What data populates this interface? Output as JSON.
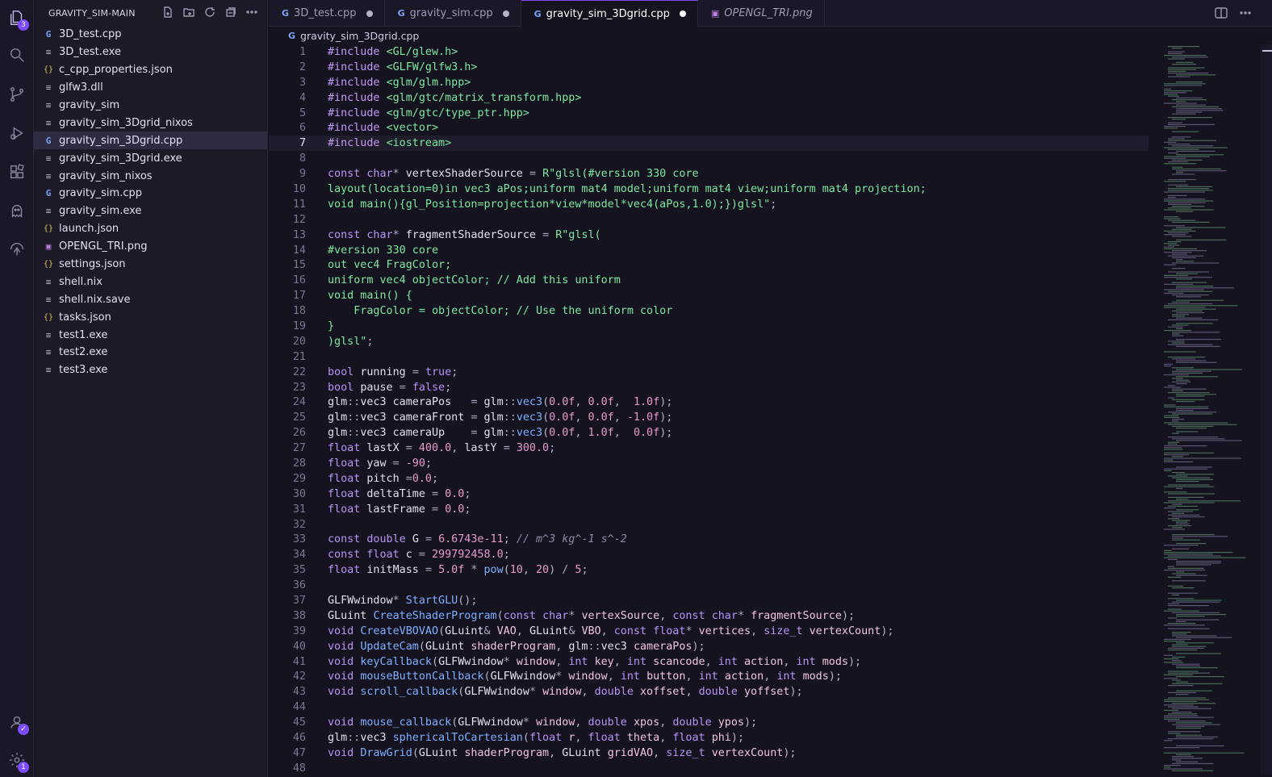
{
  "activity_bar": {
    "explorer_badge": "3",
    "settings_badge": "1"
  },
  "sidebar": {
    "title": "GRAVITY_SIM-MAIN",
    "files": [
      {
        "name": "3D_test.cpp",
        "icon": "cpp"
      },
      {
        "name": "3D_test.exe",
        "icon": "txt"
      },
      {
        "name": "c_cpp_properties.json",
        "icon": "json"
      },
      {
        "name": "glfw3.dll",
        "icon": "txt"
      },
      {
        "name": "gravity_sim",
        "icon": "txt"
      },
      {
        "name": "gravity_sim_3Dgrid_nixos",
        "icon": "txt"
      },
      {
        "name": "gravity_sim_3Dgrid.cpp",
        "icon": "cpp",
        "selected": true
      },
      {
        "name": "gravity_sim_3Dgrid.exe",
        "icon": "txt"
      },
      {
        "name": "gravity_sim_nixos",
        "icon": "txt"
      },
      {
        "name": "gravity_sim.cpp",
        "icon": "cpp"
      },
      {
        "name": "gravity_sim.exe",
        "icon": "txt"
      },
      {
        "name": "launch.json",
        "icon": "json"
      },
      {
        "name": "OPENGL_TRI.png",
        "icon": "png"
      },
      {
        "name": "settings.json",
        "icon": "json"
      },
      {
        "name": "shell.nix",
        "icon": "txt"
      },
      {
        "name": "shell.nix.save",
        "icon": "txt"
      },
      {
        "name": "tasks.json",
        "icon": "json"
      },
      {
        "name": "test1.exe",
        "icon": "txt"
      },
      {
        "name": "test2.exe",
        "icon": "txt"
      },
      {
        "name": "test3.exe",
        "icon": "txt"
      }
    ]
  },
  "tabs": [
    {
      "label": "3D_test.cpp",
      "icon": "cpp",
      "modified": true,
      "active": false
    },
    {
      "label": "gravity_sim.cpp",
      "icon": "cpp",
      "modified": true,
      "active": false
    },
    {
      "label": "gravity_sim_3Dgrid.cpp",
      "icon": "cpp",
      "modified": true,
      "active": true
    },
    {
      "label": "OPENGL_TRI.png",
      "icon": "png",
      "modified": false,
      "active": false,
      "italic": true
    }
  ],
  "breadcrumb": "gravity_sim_3Dgrid.cpp",
  "current_line": 7,
  "code_lines": [
    [
      [
        "pp",
        "#include "
      ],
      [
        "s",
        "<GL/glew.h>"
      ]
    ],
    [
      [
        "pp",
        "#include "
      ],
      [
        "s",
        "<GLFW/glfw3.h>"
      ]
    ],
    [
      [
        "pp",
        "#include "
      ],
      [
        "s",
        "<glm/glm.hpp>"
      ]
    ],
    [
      [
        "pp",
        "#include "
      ],
      [
        "s",
        "<glm/gtc/matrix_transform.hpp>"
      ]
    ],
    [
      [
        "pp",
        "#include "
      ],
      [
        "s",
        "<glm/gtc/type_ptr.hpp>"
      ]
    ],
    [
      [
        "pp",
        "#include "
      ],
      [
        "s",
        "<vector>"
      ]
    ],
    [
      [
        "pp",
        "#include "
      ],
      [
        "s",
        "<iostream>"
      ]
    ],
    [],
    [
      [
        "k",
        "const "
      ],
      [
        "t",
        "char"
      ],
      [
        "op",
        "* "
      ],
      [
        "v",
        "vertexShaderSource "
      ],
      [
        "op",
        "= "
      ],
      [
        "s",
        "R\"glsl(#version 330 core"
      ]
    ],
    [
      [
        "s",
        "layout(location=0)in vec3 aPos;uniform mat4 model;uniform mat4 view;uniform mat4 projection;"
      ]
    ],
    [
      [
        "s",
        "void main(){gl_Position=projection*view*model*vec4(aPos,1.0);})glsl\""
      ],
      [
        "p",
        ";"
      ]
    ],
    [],
    [
      [
        "k",
        "const "
      ],
      [
        "t",
        "char"
      ],
      [
        "op",
        "* "
      ],
      [
        "v",
        "fragmentShaderSource "
      ],
      [
        "op",
        "= "
      ],
      [
        "s",
        "R\"glsl("
      ]
    ],
    [
      [
        "s",
        "#version 330 core"
      ]
    ],
    [
      [
        "s",
        "out vec4 FragColor;"
      ]
    ],
    [
      [
        "s",
        "uniform vec4 objectColor; // Add this uniform"
      ]
    ],
    [
      [
        "s",
        "void main() {"
      ]
    ],
    [
      [
        "s",
        "    FragColor = objectColor; // Use the uniform color"
      ]
    ],
    [
      [
        "s",
        "}"
      ]
    ],
    [
      [
        "s",
        ")glsl\""
      ],
      [
        "p",
        ";"
      ]
    ],
    [],
    [
      [
        "t",
        "bool "
      ],
      [
        "v",
        "running "
      ],
      [
        "op",
        "= "
      ],
      [
        "k",
        "true"
      ],
      [
        "p",
        ";"
      ]
    ],
    [
      [
        "t",
        "bool "
      ],
      [
        "v",
        "pause "
      ],
      [
        "op",
        "= "
      ],
      [
        "k",
        "false"
      ],
      [
        "p",
        ";"
      ]
    ],
    [
      [
        "v",
        "glm"
      ],
      [
        "op",
        "::"
      ],
      [
        "v",
        "vec3 cameraPos   "
      ],
      [
        "op",
        "= "
      ],
      [
        "v",
        "glm"
      ],
      [
        "op",
        "::"
      ],
      [
        "f",
        "vec3"
      ],
      [
        "p",
        "("
      ],
      [
        "n",
        "0.0f"
      ],
      [
        "p",
        ", "
      ],
      [
        "n",
        "0.0f"
      ],
      [
        "p",
        ",  "
      ],
      [
        "n",
        "1.0f"
      ],
      [
        "p",
        ");"
      ]
    ],
    [
      [
        "v",
        "glm"
      ],
      [
        "op",
        "::"
      ],
      [
        "v",
        "vec3 cameraFront "
      ],
      [
        "op",
        "= "
      ],
      [
        "v",
        "glm"
      ],
      [
        "op",
        "::"
      ],
      [
        "f",
        "vec3"
      ],
      [
        "p",
        "("
      ],
      [
        "n",
        "0.0f"
      ],
      [
        "p",
        ", "
      ],
      [
        "n",
        "0.0f"
      ],
      [
        "p",
        ", "
      ],
      [
        "n",
        "-1.0f"
      ],
      [
        "p",
        ");"
      ]
    ],
    [
      [
        "v",
        "glm"
      ],
      [
        "op",
        "::"
      ],
      [
        "v",
        "vec3 cameraUp    "
      ],
      [
        "op",
        "= "
      ],
      [
        "v",
        "glm"
      ],
      [
        "op",
        "::"
      ],
      [
        "f",
        "vec3"
      ],
      [
        "p",
        "("
      ],
      [
        "n",
        "0.0f"
      ],
      [
        "p",
        ", "
      ],
      [
        "n",
        "1.0f"
      ],
      [
        "p",
        ",  "
      ],
      [
        "n",
        "0.0f"
      ],
      [
        "p",
        ");"
      ]
    ],
    [
      [
        "t",
        "float "
      ],
      [
        "v",
        "lastX "
      ],
      [
        "op",
        "= "
      ],
      [
        "n",
        "400.0"
      ],
      [
        "p",
        ", "
      ],
      [
        "v",
        "lastY "
      ],
      [
        "op",
        "= "
      ],
      [
        "n",
        "300.0"
      ],
      [
        "p",
        ";"
      ]
    ],
    [
      [
        "t",
        "float "
      ],
      [
        "v",
        "yaw "
      ],
      [
        "op",
        "= "
      ],
      [
        "n",
        "-90"
      ],
      [
        "p",
        ";"
      ]
    ],
    [
      [
        "t",
        "float "
      ],
      [
        "v",
        "pitch "
      ],
      [
        "op",
        "="
      ],
      [
        "n",
        "0.0"
      ],
      [
        "p",
        ";"
      ]
    ],
    [
      [
        "t",
        "float "
      ],
      [
        "v",
        "deltaTime "
      ],
      [
        "op",
        "= "
      ],
      [
        "n",
        "0.0"
      ],
      [
        "p",
        ";"
      ]
    ],
    [
      [
        "t",
        "float "
      ],
      [
        "v",
        "lastFrame "
      ],
      [
        "op",
        "= "
      ],
      [
        "n",
        "0.0"
      ],
      [
        "p",
        ";"
      ]
    ],
    [],
    [
      [
        "k",
        "const "
      ],
      [
        "t",
        "double "
      ],
      [
        "v",
        "G "
      ],
      [
        "op",
        "= "
      ],
      [
        "n",
        "6.6743e-11"
      ],
      [
        "p",
        "; "
      ],
      [
        "c",
        "// m^3 kg^-1 s^-2"
      ]
    ],
    [
      [
        "k",
        "const "
      ],
      [
        "t",
        "float "
      ],
      [
        "v",
        "c "
      ],
      [
        "op",
        "= "
      ],
      [
        "n",
        "299792458.0"
      ],
      [
        "p",
        ";"
      ]
    ],
    [
      [
        "t",
        "float "
      ],
      [
        "v",
        "initMass "
      ],
      [
        "op",
        "= "
      ],
      [
        "n",
        "5.0f "
      ],
      [
        "op",
        "* "
      ],
      [
        "f",
        "pow"
      ],
      [
        "p",
        "("
      ],
      [
        "n",
        "10"
      ],
      [
        "p",
        ", "
      ],
      [
        "n",
        "20"
      ],
      [
        "p",
        ") "
      ],
      [
        "op",
        "/ "
      ],
      [
        "n",
        "5"
      ],
      [
        "p",
        ";"
      ]
    ],
    [],
    [
      [
        "v",
        "GLFWwindow"
      ],
      [
        "op",
        "* "
      ],
      [
        "f",
        "StartGLU"
      ],
      [
        "p",
        "();"
      ]
    ],
    [
      [
        "v",
        "GLuint "
      ],
      [
        "f",
        "CreateShaderProgram"
      ],
      [
        "p",
        "("
      ],
      [
        "k",
        "const "
      ],
      [
        "t",
        "char"
      ],
      [
        "op",
        "* "
      ],
      [
        "pm",
        "vertexSource"
      ],
      [
        "p",
        ", "
      ],
      [
        "k",
        "const "
      ],
      [
        "t",
        "char"
      ],
      [
        "op",
        "* "
      ],
      [
        "pm",
        "fragmentSource"
      ],
      [
        "p",
        ");"
      ]
    ],
    [
      [
        "t",
        "void "
      ],
      [
        "f",
        "CreateVBOVAO"
      ],
      [
        "p",
        "("
      ],
      [
        "v",
        "GLuint"
      ],
      [
        "op",
        "& "
      ],
      [
        "pm",
        "VAO"
      ],
      [
        "p",
        ", "
      ],
      [
        "v",
        "GLuint"
      ],
      [
        "op",
        "& "
      ],
      [
        "pm",
        "VBO"
      ],
      [
        "p",
        ", "
      ],
      [
        "k",
        "const "
      ],
      [
        "t",
        "float"
      ],
      [
        "op",
        "* "
      ],
      [
        "pm",
        "vertices"
      ],
      [
        "p",
        ", "
      ],
      [
        "t",
        "size_t "
      ],
      [
        "pm",
        "vertexCount"
      ],
      [
        "p",
        ");"
      ]
    ],
    [
      [
        "t",
        "void "
      ],
      [
        "f",
        "UpdateCam"
      ],
      [
        "p",
        "("
      ],
      [
        "v",
        "GLuint "
      ],
      [
        "pm",
        "shaderProgram"
      ],
      [
        "p",
        ", "
      ],
      [
        "v",
        "glm"
      ],
      [
        "op",
        "::"
      ],
      [
        "v",
        "vec3 "
      ],
      [
        "pm",
        "cameraPos"
      ],
      [
        "p",
        ");"
      ]
    ],
    [
      [
        "t",
        "void "
      ],
      [
        "f",
        "keyCallback"
      ],
      [
        "p",
        "("
      ],
      [
        "v",
        "GLFWwindow"
      ],
      [
        "op",
        "* "
      ],
      [
        "pm",
        "window"
      ],
      [
        "p",
        ", "
      ],
      [
        "t",
        "int "
      ],
      [
        "pm",
        "key"
      ],
      [
        "p",
        ", "
      ],
      [
        "t",
        "int "
      ],
      [
        "pm",
        "scancode"
      ],
      [
        "p",
        ", "
      ],
      [
        "t",
        "int "
      ],
      [
        "pm",
        "action"
      ],
      [
        "p",
        ", "
      ],
      [
        "t",
        "int "
      ],
      [
        "pm",
        "mods"
      ],
      [
        "p",
        ");"
      ]
    ],
    [
      [
        "t",
        "void "
      ],
      [
        "f",
        "mouseButtonCallback"
      ],
      [
        "p",
        "("
      ],
      [
        "v",
        "GLFWwindow"
      ],
      [
        "op",
        "* "
      ],
      [
        "pm",
        "window"
      ],
      [
        "p",
        ", "
      ],
      [
        "t",
        "int "
      ],
      [
        "pm",
        "button"
      ],
      [
        "p",
        ", "
      ],
      [
        "t",
        "int "
      ],
      [
        "pm",
        "action"
      ],
      [
        "p",
        ", "
      ],
      [
        "t",
        "int "
      ],
      [
        "pm",
        "mods"
      ],
      [
        "p",
        ");"
      ]
    ],
    [
      [
        "t",
        "void "
      ],
      [
        "f",
        "scroll_callback"
      ],
      [
        "p",
        "("
      ],
      [
        "v",
        "GLFWwindow"
      ],
      [
        "op",
        "* "
      ],
      [
        "pm",
        "window"
      ],
      [
        "p",
        ", "
      ],
      [
        "t",
        "double "
      ],
      [
        "pm",
        "xoffset"
      ],
      [
        "p",
        ", "
      ],
      [
        "t",
        "double "
      ],
      [
        "pm",
        "yoffset"
      ],
      [
        "p",
        ");"
      ]
    ],
    [],
    [
      [
        "t",
        "void "
      ],
      [
        "f",
        "mouse_callback"
      ],
      [
        "p",
        "("
      ],
      [
        "v",
        "GLFWwindow"
      ],
      [
        "op",
        "* "
      ],
      [
        "pm",
        "window"
      ],
      [
        "p",
        ", "
      ],
      [
        "t",
        "double "
      ],
      [
        "pm",
        "xpos"
      ],
      [
        "p",
        ", "
      ],
      [
        "t",
        "double "
      ],
      [
        "pm",
        "ypos"
      ],
      [
        "p",
        ");"
      ]
    ],
    [
      [
        "v",
        "glm"
      ],
      [
        "op",
        "::"
      ],
      [
        "v",
        "vec3 "
      ],
      [
        "f",
        "sphericalToCartesian"
      ],
      [
        "p",
        "("
      ],
      [
        "t",
        "float "
      ],
      [
        "pm",
        "r"
      ],
      [
        "p",
        ", "
      ],
      [
        "t",
        "float "
      ],
      [
        "pm",
        "theta"
      ],
      [
        "p",
        ", "
      ],
      [
        "t",
        "float "
      ],
      [
        "pm",
        "phi"
      ],
      [
        "p",
        ");"
      ]
    ],
    [
      [
        "t",
        "void "
      ],
      [
        "f",
        "DrawGrid"
      ],
      [
        "p",
        "("
      ],
      [
        "v",
        "GLuint "
      ],
      [
        "pm",
        "shaderProgram"
      ],
      [
        "p",
        ", "
      ],
      [
        "v",
        "GLuint "
      ],
      [
        "pm",
        "gridVAO"
      ],
      [
        "p",
        ", "
      ],
      [
        "t",
        "size_t "
      ],
      [
        "pm",
        "vertexCount"
      ],
      [
        "p",
        ");"
      ]
    ],
    []
  ],
  "colors": {
    "accent": "#7c4dff",
    "background": "#15131f",
    "keyword": "#b794f6",
    "string": "#7ee8a0",
    "number": "#e89bc9",
    "function": "#7fb0ff"
  }
}
